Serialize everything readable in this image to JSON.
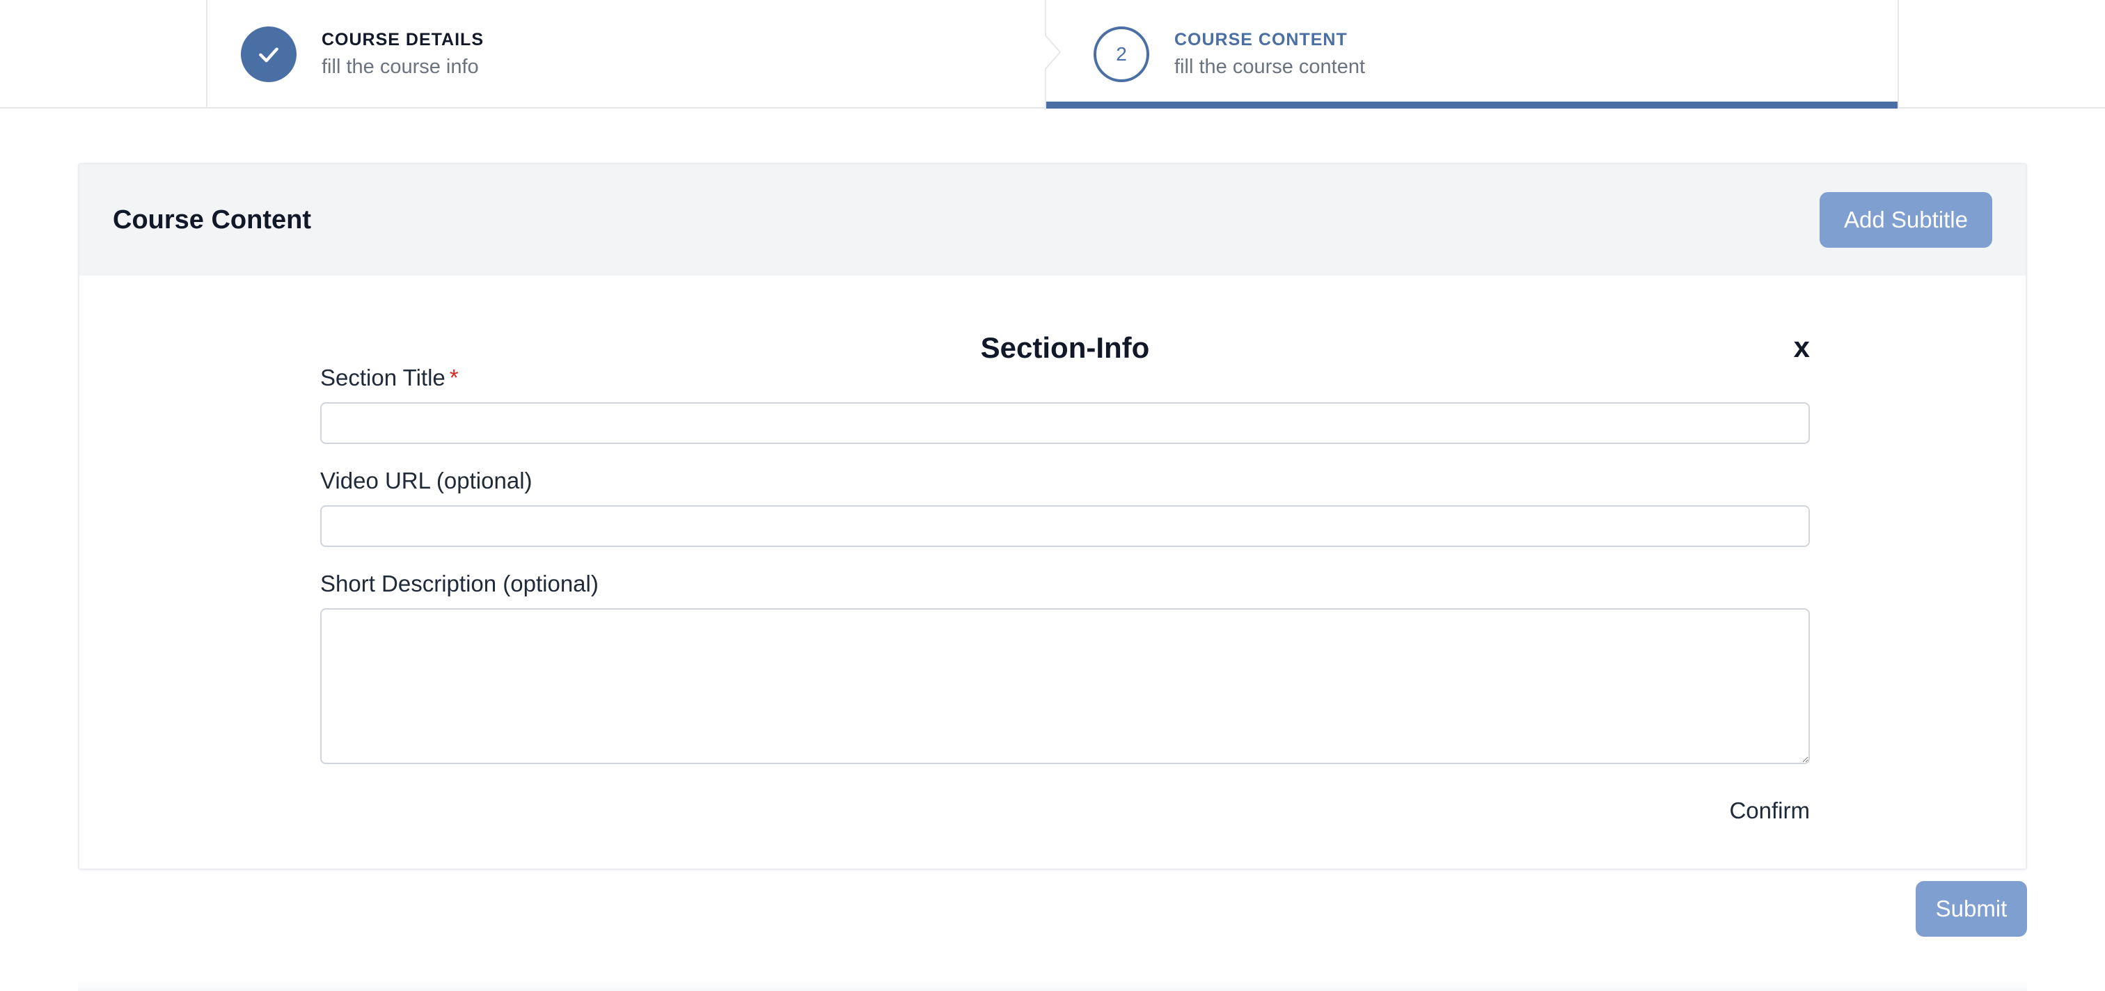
{
  "stepper": {
    "steps": [
      {
        "title": "COURSE DETAILS",
        "subtitle": "fill the course info",
        "status": "complete",
        "icon": "check-icon"
      },
      {
        "number": "2",
        "title": "COURSE CONTENT",
        "subtitle": "fill the course content",
        "status": "current"
      }
    ]
  },
  "card": {
    "title": "Course Content",
    "add_subtitle_label": "Add Subtitle"
  },
  "section": {
    "heading": "Section-Info",
    "close_label": "x",
    "title_label": "Section Title",
    "required_mark": "*",
    "title_value": "",
    "video_label": "Video URL (optional)",
    "video_value": "",
    "description_label": "Short Description (optional)",
    "description_value": "",
    "confirm_label": "Confirm"
  },
  "submit_label": "Submit",
  "colors": {
    "accent": "#4a6fa5",
    "button": "#7f9fd0",
    "required": "#dc2626",
    "header_bg": "#f3f4f6"
  }
}
